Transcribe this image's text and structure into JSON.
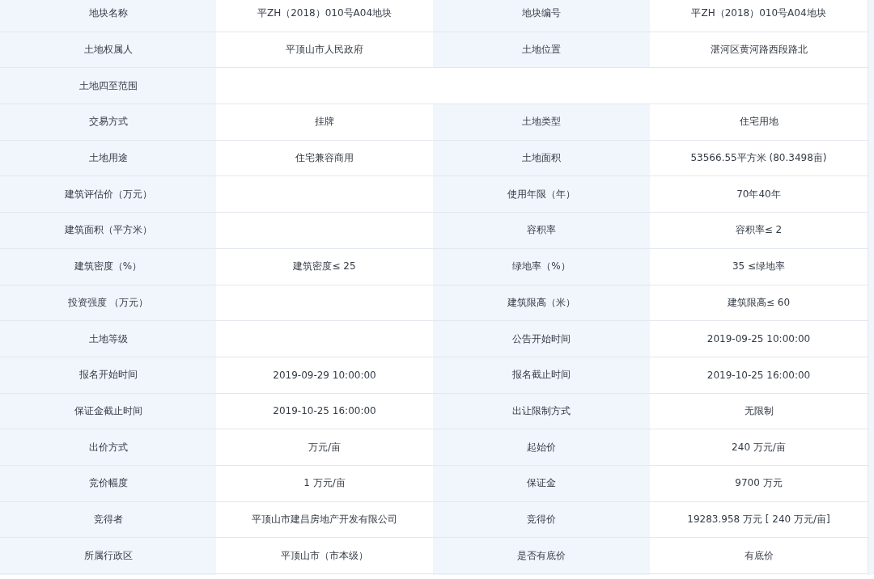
{
  "rows": [
    {
      "cells": [
        {
          "kind": "label",
          "text": "地块名称"
        },
        {
          "kind": "value",
          "text": "平ZH（2018）010号A04地块"
        },
        {
          "kind": "label",
          "text": "地块编号"
        },
        {
          "kind": "value",
          "text": "平ZH（2018）010号A04地块"
        }
      ]
    },
    {
      "cells": [
        {
          "kind": "label",
          "text": "土地权属人"
        },
        {
          "kind": "value",
          "text": "平顶山市人民政府"
        },
        {
          "kind": "label",
          "text": "土地位置"
        },
        {
          "kind": "value",
          "text": "湛河区黄河路西段路北"
        }
      ]
    },
    {
      "cells": [
        {
          "kind": "label",
          "text": "土地四至范围"
        },
        {
          "kind": "wide"
        }
      ]
    },
    {
      "cells": [
        {
          "kind": "label",
          "text": "交易方式"
        },
        {
          "kind": "value",
          "text": "挂牌"
        },
        {
          "kind": "label",
          "text": "土地类型"
        },
        {
          "kind": "value",
          "text": "住宅用地"
        }
      ]
    },
    {
      "cells": [
        {
          "kind": "label",
          "text": "土地用途"
        },
        {
          "kind": "value",
          "text": "住宅兼容商用"
        },
        {
          "kind": "label",
          "text": "土地面积"
        },
        {
          "kind": "value",
          "text": "53566.55平方米 (80.3498亩)"
        }
      ]
    },
    {
      "cells": [
        {
          "kind": "label",
          "text": "建筑评估价（万元）"
        },
        {
          "kind": "value"
        },
        {
          "kind": "label",
          "text": "使用年限（年）"
        },
        {
          "kind": "value",
          "text": "70年40年"
        }
      ]
    },
    {
      "cells": [
        {
          "kind": "label",
          "text": "建筑面积（平方米）"
        },
        {
          "kind": "value"
        },
        {
          "kind": "label",
          "text": "容积率"
        },
        {
          "kind": "value",
          "text": "容积率≤ 2"
        }
      ]
    },
    {
      "cells": [
        {
          "kind": "label",
          "text": "建筑密度（%）"
        },
        {
          "kind": "value",
          "text": "建筑密度≤ 25"
        },
        {
          "kind": "label",
          "text": "绿地率（%）"
        },
        {
          "kind": "value",
          "text": "35 ≤绿地率"
        }
      ]
    },
    {
      "cells": [
        {
          "kind": "label",
          "text": "投资强度 （万元）"
        },
        {
          "kind": "value"
        },
        {
          "kind": "label",
          "text": "建筑限高（米）"
        },
        {
          "kind": "value",
          "text": "建筑限高≤ 60"
        }
      ]
    },
    {
      "cells": [
        {
          "kind": "label",
          "text": "土地等级"
        },
        {
          "kind": "value"
        },
        {
          "kind": "label",
          "text": "公告开始时间"
        },
        {
          "kind": "value",
          "text": "2019-09-25 10:00:00"
        }
      ]
    },
    {
      "cells": [
        {
          "kind": "label",
          "text": "报名开始时间"
        },
        {
          "kind": "value",
          "text": "2019-09-29 10:00:00"
        },
        {
          "kind": "label",
          "text": "报名截止时间"
        },
        {
          "kind": "value",
          "text": "2019-10-25 16:00:00"
        }
      ]
    },
    {
      "cells": [
        {
          "kind": "label",
          "text": "保证金截止时间"
        },
        {
          "kind": "value",
          "text": "2019-10-25 16:00:00"
        },
        {
          "kind": "label",
          "text": "出让限制方式"
        },
        {
          "kind": "value",
          "text": "无限制"
        }
      ]
    },
    {
      "cells": [
        {
          "kind": "label",
          "text": "出价方式"
        },
        {
          "kind": "value",
          "text": "万元/亩"
        },
        {
          "kind": "label",
          "text": "起始价"
        },
        {
          "kind": "value",
          "text": "240 万元/亩"
        }
      ]
    },
    {
      "cells": [
        {
          "kind": "label",
          "text": "竞价幅度"
        },
        {
          "kind": "value",
          "text": "1 万元/亩"
        },
        {
          "kind": "label",
          "text": "保证金"
        },
        {
          "kind": "value",
          "text": "9700 万元"
        }
      ]
    },
    {
      "cells": [
        {
          "kind": "label",
          "text": "竞得者"
        },
        {
          "kind": "value",
          "text": "平顶山市建昌房地产开发有限公司"
        },
        {
          "kind": "label",
          "text": "竞得价"
        },
        {
          "kind": "value",
          "text": "19283.958 万元 [ 240 万元/亩]"
        }
      ]
    },
    {
      "cells": [
        {
          "kind": "label",
          "text": "所属行政区"
        },
        {
          "kind": "value",
          "text": "平顶山市（市本级）"
        },
        {
          "kind": "label",
          "text": "是否有底价"
        },
        {
          "kind": "value",
          "text": "有底价"
        }
      ]
    }
  ]
}
